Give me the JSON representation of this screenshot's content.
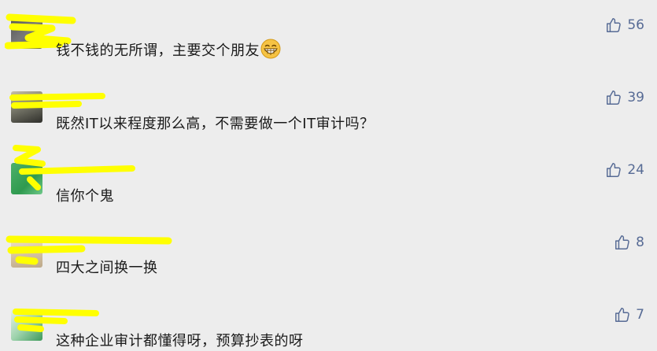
{
  "colors": {
    "background": "#ededed",
    "text": "#1a1a1a",
    "nickname": "#8a8a8a",
    "like": "#576b95",
    "redaction_marker": "#ffff00"
  },
  "comments": [
    {
      "nickname": "",
      "text": "钱不钱的无所谓，主要交个朋友",
      "emoji": "grinning-face",
      "likes": "56",
      "icon": "thumbs-up-icon"
    },
    {
      "nickname": "",
      "text": "既然IT以来程度那么高，不需要做一个IT审计吗？",
      "likes": "39",
      "icon": "thumbs-up-icon"
    },
    {
      "nickname": "",
      "text": "信你个鬼",
      "likes": "24",
      "icon": "thumbs-up-icon"
    },
    {
      "nickname": "",
      "text": "四大之间换一换",
      "likes": "8",
      "icon": "thumbs-up-icon"
    },
    {
      "nickname": "",
      "text": "这种企业审计都懂得呀，预算抄表的呀",
      "likes": "7",
      "icon": "thumbs-up-icon"
    }
  ]
}
